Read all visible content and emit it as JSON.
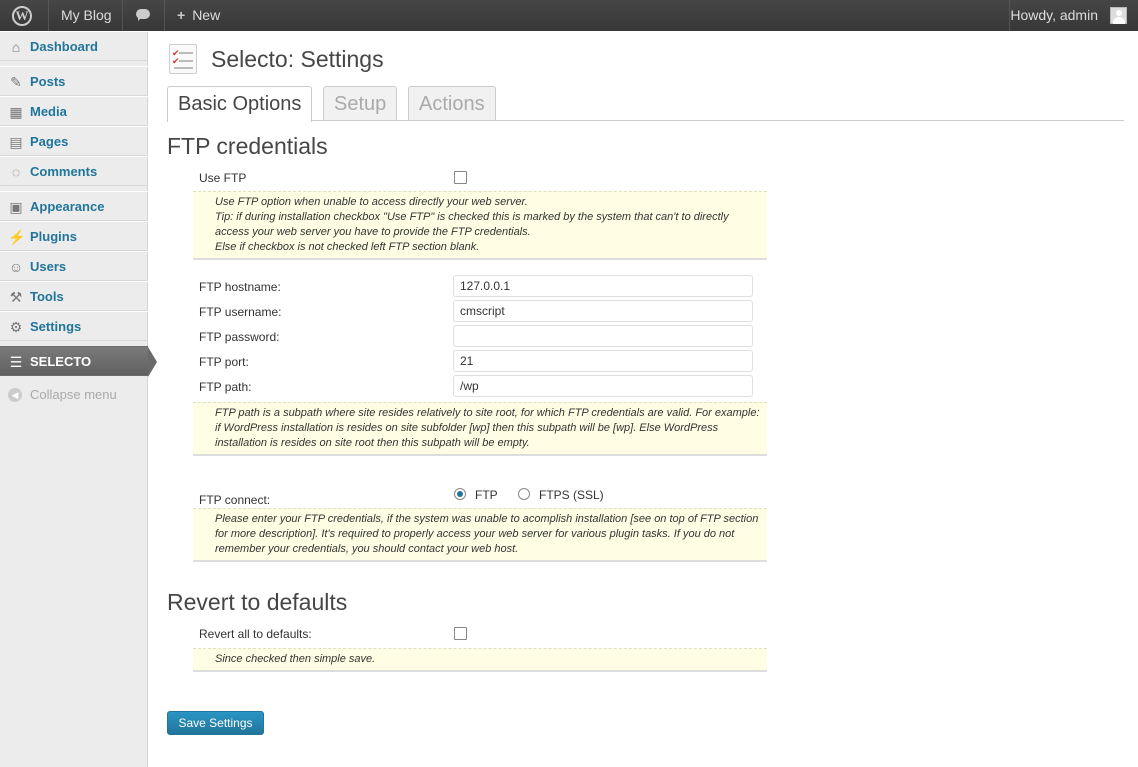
{
  "admin_bar": {
    "wp_logo_icon": "wordpress-icon",
    "site_name": "My Blog",
    "comments_icon": "comment-bubble-icon",
    "new_label": "New",
    "greeting": "Howdy, admin"
  },
  "sidebar": {
    "items": [
      {
        "label": "Dashboard",
        "icon": "home-icon"
      },
      {
        "label": "Posts",
        "icon": "pin-icon"
      },
      {
        "label": "Media",
        "icon": "media-icon"
      },
      {
        "label": "Pages",
        "icon": "pages-icon"
      },
      {
        "label": "Comments",
        "icon": "comments-icon"
      },
      {
        "label": "Appearance",
        "icon": "appearance-icon"
      },
      {
        "label": "Plugins",
        "icon": "plugin-icon"
      },
      {
        "label": "Users",
        "icon": "users-icon"
      },
      {
        "label": "Tools",
        "icon": "tools-icon"
      },
      {
        "label": "Settings",
        "icon": "settings-icon"
      },
      {
        "label": "SELECTO",
        "icon": "selecto-icon"
      }
    ],
    "collapse_label": "Collapse menu"
  },
  "page": {
    "title": "Selecto: Settings",
    "tabs": [
      "Basic Options",
      "Setup",
      "Actions"
    ],
    "active_tab": "Basic Options"
  },
  "ftp": {
    "heading": "FTP credentials",
    "use_ftp_label": "Use FTP",
    "use_ftp_checked": false,
    "use_ftp_note": [
      "Use FTP option when unable to access directly your web server.",
      "Tip: if during installation checkbox \"Use FTP\" is checked this is marked by the system that can't to directly",
      "access your web server you have to provide the FTP credentials.",
      "Else if checkbox is not checked left FTP section blank."
    ],
    "hostname_label": "FTP hostname:",
    "hostname_value": "127.0.0.1",
    "username_label": "FTP username:",
    "username_value": "cmscript",
    "password_label": "FTP password:",
    "password_value": "",
    "port_label": "FTP port:",
    "port_value": "21",
    "path_label": "FTP path:",
    "path_value": "/wp",
    "path_note": [
      "FTP path is a subpath where site resides relatively to site root, for which FTP credentials are valid. For example:",
      "if WordPress installation is resides on site subfolder [wp] then this subpath will be [wp]. Else WordPress",
      "installation is resides on site root then this subpath will be empty."
    ],
    "connect_label": "FTP connect:",
    "connect_options": [
      "FTP",
      "FTPS (SSL)"
    ],
    "connect_selected": "FTP",
    "connect_note": [
      "Please enter your FTP credentials, if the system was unable to acomplish installation [see on top of FTP section",
      "for more description]. It's required to properly access your web server for various plugin tasks. If you do not",
      "remember your credentials, you should contact your web host."
    ]
  },
  "revert": {
    "heading": "Revert to defaults",
    "label": "Revert all to defaults:",
    "checked": false,
    "note": "Since checked then simple save."
  },
  "save_label": "Save Settings",
  "colors": {
    "admin_bar": "#464646",
    "link_blue": "#21759b",
    "note_bg": "#fffee4",
    "active_menu": "#6d6d6d"
  }
}
